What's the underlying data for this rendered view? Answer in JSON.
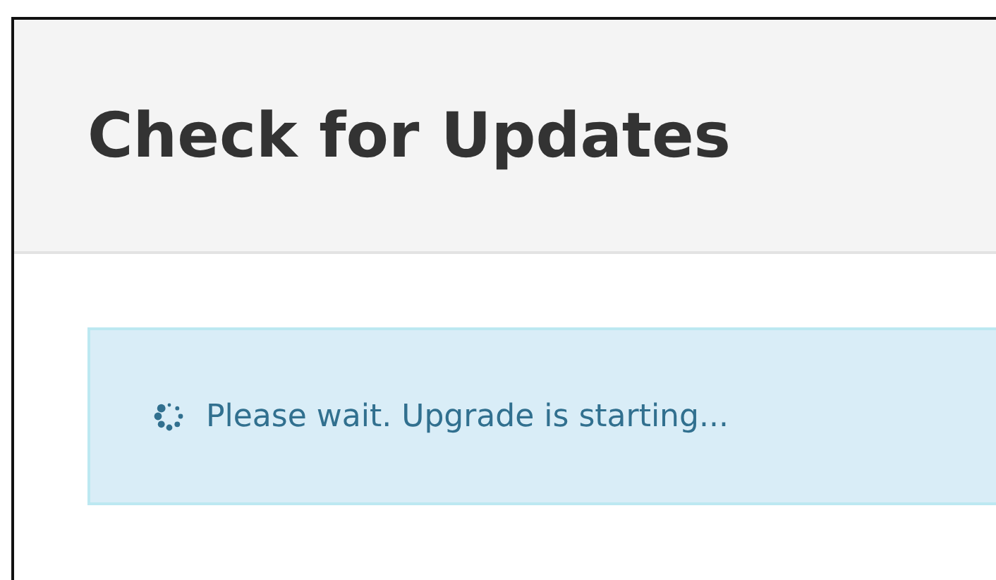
{
  "header": {
    "title": "Check for Updates"
  },
  "alert": {
    "message": "Please wait. Upgrade is starting..."
  }
}
